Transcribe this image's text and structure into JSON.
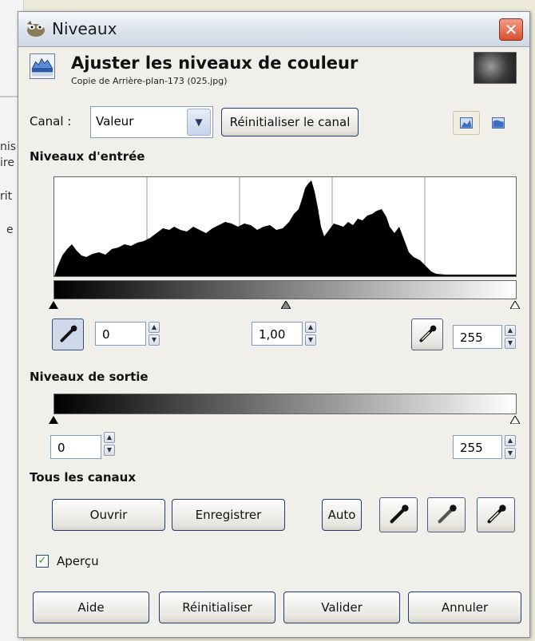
{
  "background_app": {
    "fragments": [
      "nis",
      "ire",
      "rit",
      "e"
    ]
  },
  "window": {
    "title": "Niveaux",
    "close_glyph": "✕"
  },
  "header": {
    "title": "Ajuster les niveaux de couleur",
    "subtitle": "Copie de Arrière-plan-173 (025.jpg)"
  },
  "channel": {
    "label": "Canal :",
    "value": "Valeur",
    "reset_button": "Réinitialiser le canal",
    "dropdown_glyph": "▼"
  },
  "input_levels": {
    "heading": "Niveaux d'entrée",
    "black": "0",
    "gamma": "1,00",
    "white": "255"
  },
  "output_levels": {
    "heading": "Niveaux de sortie",
    "black": "0",
    "white": "255"
  },
  "all_channels": {
    "heading": "Tous les canaux",
    "open_button": "Ouvrir",
    "save_button": "Enregistrer",
    "auto_button": "Auto"
  },
  "preview": {
    "label": "Aperçu",
    "checked": true,
    "check_glyph": "✓"
  },
  "footer": {
    "help_button": "Aide",
    "reset_button": "Réinitialiser",
    "ok_button": "Valider",
    "cancel_button": "Annuler"
  },
  "icons": {
    "title_icon": "gimp-wilber-icon",
    "header_icon": "levels-icon",
    "linear_histogram_icon": "linear-histogram-icon",
    "log_histogram_icon": "logarithmic-histogram-icon",
    "eyedropper": "eyedropper-icon"
  },
  "colors": {
    "accent_border": "#1e3d74",
    "check_green": "#21a121",
    "close_red": "#d9502f"
  }
}
